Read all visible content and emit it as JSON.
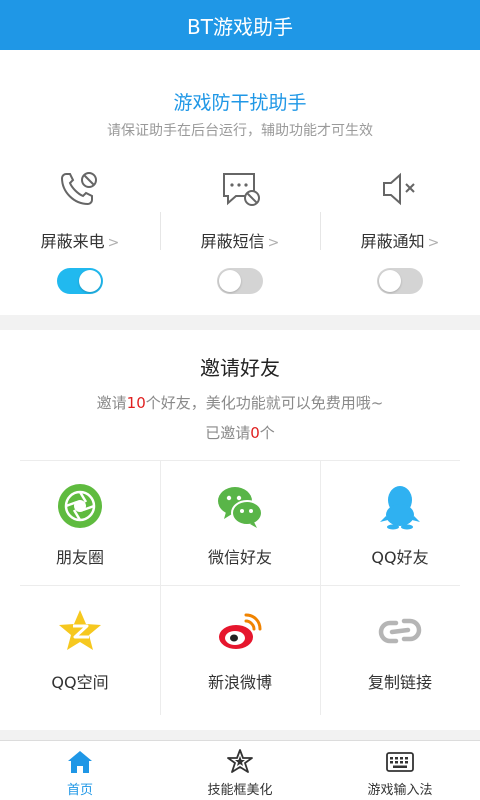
{
  "header": {
    "title": "BT游戏助手"
  },
  "anti_disturb": {
    "title": "游戏防干扰助手",
    "subtitle": "请保证助手在后台运行，辅助功能才可生效",
    "features": [
      {
        "label": "屏蔽来电",
        "icon": "phone-blocked-icon",
        "enabled": true
      },
      {
        "label": "屏蔽短信",
        "icon": "sms-blocked-icon",
        "enabled": false
      },
      {
        "label": "屏蔽通知",
        "icon": "mute-icon",
        "enabled": false
      }
    ]
  },
  "invite": {
    "title": "邀请好友",
    "line1_pre": "邀请",
    "line1_num": "10",
    "line1_post": "个好友，美化功能就可以免费用哦~",
    "line2_pre": "已邀请",
    "line2_num": "0",
    "line2_post": "个",
    "share_items": [
      {
        "label": "朋友圈",
        "icon": "moments-icon"
      },
      {
        "label": "微信好友",
        "icon": "wechat-icon"
      },
      {
        "label": "QQ好友",
        "icon": "qq-icon"
      },
      {
        "label": "QQ空间",
        "icon": "qzone-icon"
      },
      {
        "label": "新浪微博",
        "icon": "weibo-icon"
      },
      {
        "label": "复制链接",
        "icon": "link-icon"
      }
    ]
  },
  "tabbar": {
    "items": [
      {
        "label": "首页",
        "icon": "home-icon",
        "active": true
      },
      {
        "label": "技能框美化",
        "icon": "star-frame-icon",
        "active": false
      },
      {
        "label": "游戏输入法",
        "icon": "keyboard-icon",
        "active": false
      }
    ]
  },
  "colors": {
    "accent": "#1f97e6",
    "toggle_on": "#21b9ef",
    "highlight": "#e02020"
  }
}
